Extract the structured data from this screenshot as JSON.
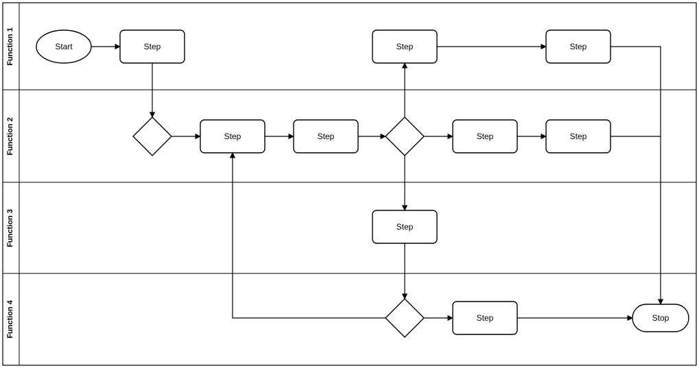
{
  "lanes": {
    "l1": "Function 1",
    "l2": "Function 2",
    "l3": "Function 3",
    "l4": "Function 4"
  },
  "nodes": {
    "start": "Start",
    "step1": "Step",
    "step2": "Step",
    "step3": "Step",
    "step4": "Step",
    "step5": "Step",
    "step6": "Step",
    "step7": "Step",
    "step8": "Step",
    "step9": "Step",
    "stop": "Stop"
  }
}
